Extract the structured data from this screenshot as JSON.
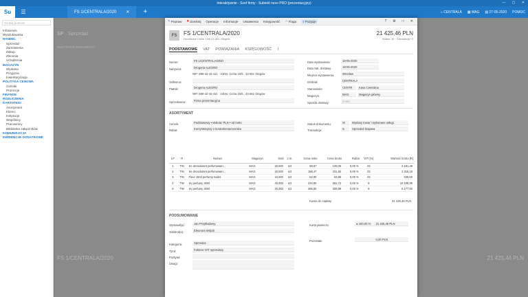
{
  "window": {
    "title": "Interaktywnie - Szef firmy - Subiekt nexo PRO (prezentacyjny)",
    "min": "—",
    "max": "▢",
    "close": "✕"
  },
  "topbar": {
    "logo": "Su",
    "doc_tab": "FS 1/CENTRALA/2020",
    "close": "✕",
    "plus": "+",
    "company": "CENTRALA",
    "store": "MAG",
    "date": "27-05-2020",
    "help": "POMOC"
  },
  "sidebar": {
    "search": "Szukaj poleceń",
    "items": [
      {
        "label": "Infoserwis",
        "type": "item"
      },
      {
        "label": "Wyszukiwarka",
        "type": "item"
      },
      {
        "label": "HANDEL",
        "type": "sec"
      },
      {
        "label": "Sprzedaż",
        "type": "sub"
      },
      {
        "label": "Zamówienia",
        "type": "sub"
      },
      {
        "label": "Zakup",
        "type": "sub"
      },
      {
        "label": "Zlecenia",
        "type": "sub"
      },
      {
        "label": "Urządzenia",
        "type": "sub"
      },
      {
        "label": "MAGAZYN",
        "type": "sec"
      },
      {
        "label": "Wydania",
        "type": "sub"
      },
      {
        "label": "Przyjęcia",
        "type": "sub"
      },
      {
        "label": "Inwentaryzacja",
        "type": "sub"
      },
      {
        "label": "POLITYKA CENOWA",
        "type": "sec"
      },
      {
        "label": "Cenniki",
        "type": "sub"
      },
      {
        "label": "Promocje",
        "type": "sub"
      },
      {
        "label": "FINANSE",
        "type": "sec"
      },
      {
        "label": "ROZLICZENIA",
        "type": "sec"
      },
      {
        "label": "KARTOTEKI",
        "type": "sec"
      },
      {
        "label": "Asortyment",
        "type": "sub"
      },
      {
        "label": "Klienci",
        "type": "sub"
      },
      {
        "label": "Instytucje",
        "type": "sub"
      },
      {
        "label": "Wspólnicy",
        "type": "sub"
      },
      {
        "label": "Pracownicy",
        "type": "sub"
      },
      {
        "label": "Biblioteka załączników",
        "type": "sub"
      },
      {
        "label": "KOMUNIKACJA",
        "type": "sec"
      },
      {
        "label": "EWIDENCJE DODATKOWE",
        "type": "sec"
      }
    ]
  },
  "background": {
    "sp": "SP",
    "title": "Sprzedaż",
    "list_title": "WSZYSTKIE DOKUMENTY",
    "doc": "FS 1/CENTRALA/2020",
    "amount": "21 425,46 PLN"
  },
  "toolbar": {
    "items": [
      {
        "icon": "pencil-icon",
        "label": "Popraw"
      },
      {
        "icon": "close-icon",
        "label": "Zamknij"
      },
      {
        "icon": "",
        "label": "Operacje"
      },
      {
        "icon": "",
        "label": "Informacje"
      },
      {
        "icon": "",
        "label": "Ustawienia"
      },
      {
        "icon": "",
        "label": "Księgowość"
      },
      {
        "icon": "star-icon",
        "label": "Flaga"
      },
      {
        "icon": "list-icon",
        "label": "Pozycje"
      }
    ],
    "right": [
      "?",
      "⚙",
      "□",
      "✕"
    ]
  },
  "doc": {
    "badge": "FS",
    "number": "FS 1/CENTRALA/2020",
    "address": "Drodowice Ciche 15/5 42-561 Głogów",
    "amount": "21 425,46 PLN",
    "status": "Status: W  ·  Transakcja: S"
  },
  "tabs": [
    "PODSTAWOWE",
    "VAT",
    "POWIĄZANIA",
    "KSIĘGOWOŚĆ"
  ],
  "fields": {
    "numer_l": "Numer:",
    "numer": "FS 1/CENTRALA/2020",
    "nabywca_l": "Nabywca:",
    "nabywca": "Drogeria ALEGRO",
    "nabywca_adr": "NIP: 888-42-42-421  · Adres: Cicha 15/5 , 42-561 Głogów",
    "odbiorca_l": "Odbiorca:",
    "platnik_l": "Płatnik:",
    "platnik": "Drogeria ALEGRO",
    "platnik_adr": "NIP: 888-42-42-421  · Adres: Cicha 15/5 , 42-561 Głogów",
    "sprzedawca_l": "Sprzedawca:",
    "sprzedawca": "Firma prezentacyjna",
    "data_wyst_l": "Data wystawienia:",
    "data_wyst": "18-05-2020",
    "data_dost_l": "Data zak. dostawy:",
    "data_dost": "18-05-2020",
    "miejsce_l": "Miejsce wystawienia:",
    "miejsce": "Wrocław",
    "oddzial_l": "Oddział:",
    "oddzial": "CENTRALA",
    "stanowisko_l": "Stanowisko:",
    "stanowisko_k": "CENTR",
    "stanowisko": "Kasa Centralna",
    "magazyn_l": "Magazyn:",
    "magazyn_k": "MAG",
    "magazyn": "Magazyn główny",
    "sposob_l": "Sposób dostawy:",
    "sposob": "(brak)"
  },
  "asortyment": {
    "title": "ASORTYMENT",
    "cennik_l": "Cennik:",
    "cennik": "Podstawowy • Waluta: PLN • od netto",
    "rabat_l": "Rabat:",
    "rabat": "Korzystniejszy z kontrahenta/cennika",
    "status_l": "Status dokumentu:",
    "status_k": "W",
    "status": "Wydany towar i wykonane usługi",
    "transakcja_l": "Transakcja:",
    "transakcja_k": "S",
    "transakcja": "Sprzedaż krajowa"
  },
  "table": {
    "headers": [
      "LP",
      "R",
      "Nazwa",
      "Magazyn",
      "Ilość",
      "J.m.",
      "Cena netto",
      "Cena brutto",
      "Rabat",
      "VAT [%]",
      "Wartość brutto [R]"
    ],
    "rows": [
      [
        "1",
        "TW",
        "Sv dezodorant perfumowan...",
        "MAG",
        "20,000",
        "szt",
        "88,67",
        "109,06",
        "0,00 %",
        "23",
        "2 181,28"
      ],
      [
        "2",
        "TW",
        "Sv dezodorant perfumowan...",
        "MAG",
        "20,000",
        "szt",
        "188,47",
        "231,82",
        "0,00 %",
        "23",
        "2 318,18"
      ],
      [
        "3",
        "TW",
        "Fleur 15ml perfumy toalet.",
        "MAG",
        "10,000",
        "szt",
        "52,00",
        "63,96",
        "0,00 %",
        "23",
        "639,60"
      ],
      [
        "4",
        "TW",
        "Sv perfumy 30ml",
        "MAG",
        "40,000",
        "szt",
        "234,00",
        "252,72",
        "0,00 %",
        "8",
        "10 108,80"
      ],
      [
        "5",
        "TW",
        "Sv perfumy 30ml",
        "MAG",
        "20,000",
        "szt",
        "286,00",
        "308,88",
        "0,00 %",
        "8",
        "6 177,60"
      ]
    ],
    "total_label": "Kwota do zapłaty:",
    "total": "21 425,46 PLN"
  },
  "podsum": {
    "title": "PODSUMOWANIE",
    "wyst_l": "Wystawił(a):",
    "wyst": "Jan Przykładowy",
    "odebr_l": "Odebrał(a):",
    "odebr": "Eleonora Wójcik",
    "kategoria_l": "Kategoria:",
    "kategoria": "Sprzedaż",
    "tytul_l": "Tytuł:",
    "tytul": "Faktura VAT sprzedaży",
    "podtytul_l": "Podtytuł:",
    "uwagi_l": "Uwagi:",
    "karta_l": "Karta płatnicza",
    "karta_pct": "100,00 %",
    "karta": "21 425,46 PLN",
    "pozostalo_l": "Pozostało",
    "pozostalo": "0,00 PLN"
  }
}
